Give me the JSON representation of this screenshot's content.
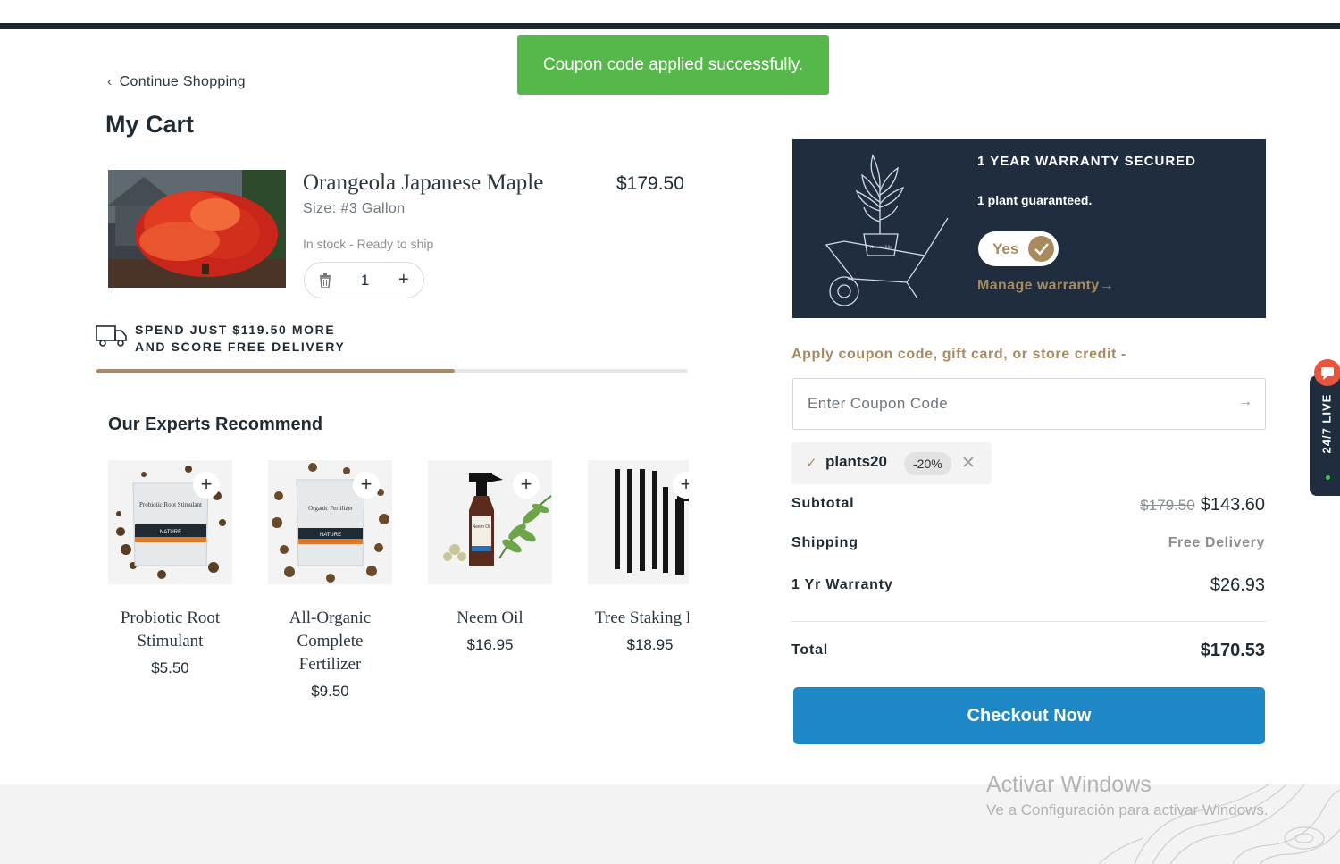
{
  "toast": {
    "message": "Coupon code applied successfully."
  },
  "nav": {
    "continue_label": "Continue Shopping"
  },
  "cart": {
    "title": "My Cart",
    "item": {
      "name": "Orangeola Japanese Maple",
      "price": "$179.50",
      "size": "Size: #3 Gallon",
      "stock": "In stock - Ready to ship",
      "quantity": "1"
    },
    "delivery": {
      "line1": "SPEND JUST $119.50 MORE",
      "line2": "AND SCORE FREE DELIVERY",
      "progress_percent": 60.5
    }
  },
  "recommend": {
    "title": "Our Experts Recommend",
    "items": [
      {
        "name": "Probiotic Root Stimulant",
        "price": "$5.50",
        "pkg_text": "Probiotic Root Stimulant",
        "pkg_brand": "NATURE"
      },
      {
        "name": "All-Organic Complete Fertilizer",
        "price": "$9.50",
        "pkg_text": "Organic Fertilizer",
        "pkg_brand": "NATURE"
      },
      {
        "name": "Neem Oil",
        "price": "$16.95",
        "pkg_text": "Neem Oil"
      },
      {
        "name": "Tree Staking Kit",
        "price": "$18.95"
      }
    ]
  },
  "warranty": {
    "title": "1 YEAR WARRANTY SECURED",
    "subtitle": "1 plant guaranteed.",
    "toggle_label": "Yes",
    "manage_label": "Manage warranty",
    "pot_label": "Nature Hills"
  },
  "coupon": {
    "label": "Apply coupon code, gift card, or store credit -",
    "placeholder": "Enter Coupon Code",
    "applied_code": "plants20",
    "applied_discount": "-20%"
  },
  "summary": {
    "subtotal_label": "Subtotal",
    "subtotal_original": "$179.50",
    "subtotal_value": "$143.60",
    "shipping_label": "Shipping",
    "shipping_value": "Free Delivery",
    "warranty_label": "1 Yr Warranty",
    "warranty_value": "$26.93",
    "total_label": "Total",
    "total_value": "$170.53"
  },
  "checkout": {
    "label": "Checkout Now"
  },
  "live_chat": {
    "label": "24/7 LIVE"
  },
  "windows_watermark": {
    "line1": "Activar Windows",
    "line2": "Ve a Configuración para activar Windows."
  },
  "colors": {
    "accent_gold": "#a88a5e",
    "navy": "#1f2d3f",
    "success_green": "#56b84a",
    "checkout_blue": "#1e88c6"
  }
}
